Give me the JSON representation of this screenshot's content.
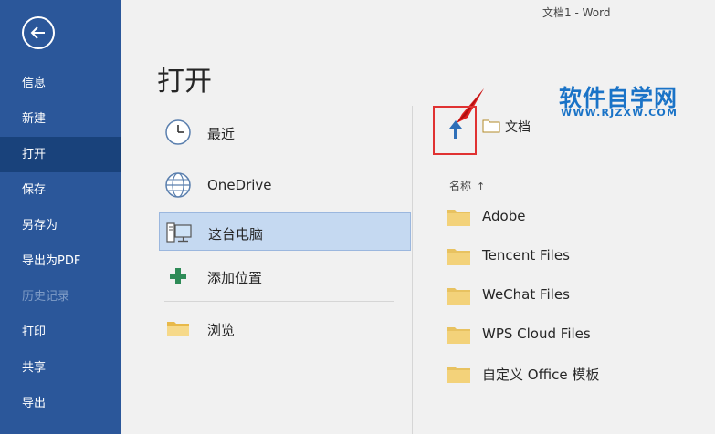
{
  "window": {
    "title": "文档1  -  Word"
  },
  "sidebar": {
    "items": [
      {
        "label": "信息"
      },
      {
        "label": "新建"
      },
      {
        "label": "打开"
      },
      {
        "label": "保存"
      },
      {
        "label": "另存为"
      },
      {
        "label": "导出为PDF"
      },
      {
        "label": "历史记录"
      },
      {
        "label": "打印"
      },
      {
        "label": "共享"
      },
      {
        "label": "导出"
      }
    ],
    "selected": "打开",
    "disabled": "历史记录"
  },
  "page": {
    "title": "打开"
  },
  "locations": [
    {
      "label": "最近",
      "icon": "clock-icon"
    },
    {
      "label": "OneDrive",
      "icon": "globe-icon"
    },
    {
      "label": "这台电脑",
      "icon": "computer-icon",
      "selected": true
    },
    {
      "label": "添加位置",
      "icon": "plus-icon"
    },
    {
      "label": "浏览",
      "icon": "folder-icon"
    }
  ],
  "browser": {
    "breadcrumb": "文档",
    "column_header": "名称",
    "sort_indicator": "↑",
    "files": [
      {
        "name": "Adobe"
      },
      {
        "name": "Tencent Files"
      },
      {
        "name": "WeChat Files"
      },
      {
        "name": "WPS Cloud Files"
      },
      {
        "name": "自定义 Office 模板"
      }
    ]
  },
  "watermark": {
    "main": "软件自学网",
    "sub": "WWW.RJZXW.COM"
  },
  "colors": {
    "sidebar": "#2b579a",
    "sidebar_selected": "#19427b",
    "selection": "#c5d9f1",
    "folder": "#f0cd6e",
    "highlight": "#e03232",
    "watermark": "#1a73c7"
  }
}
